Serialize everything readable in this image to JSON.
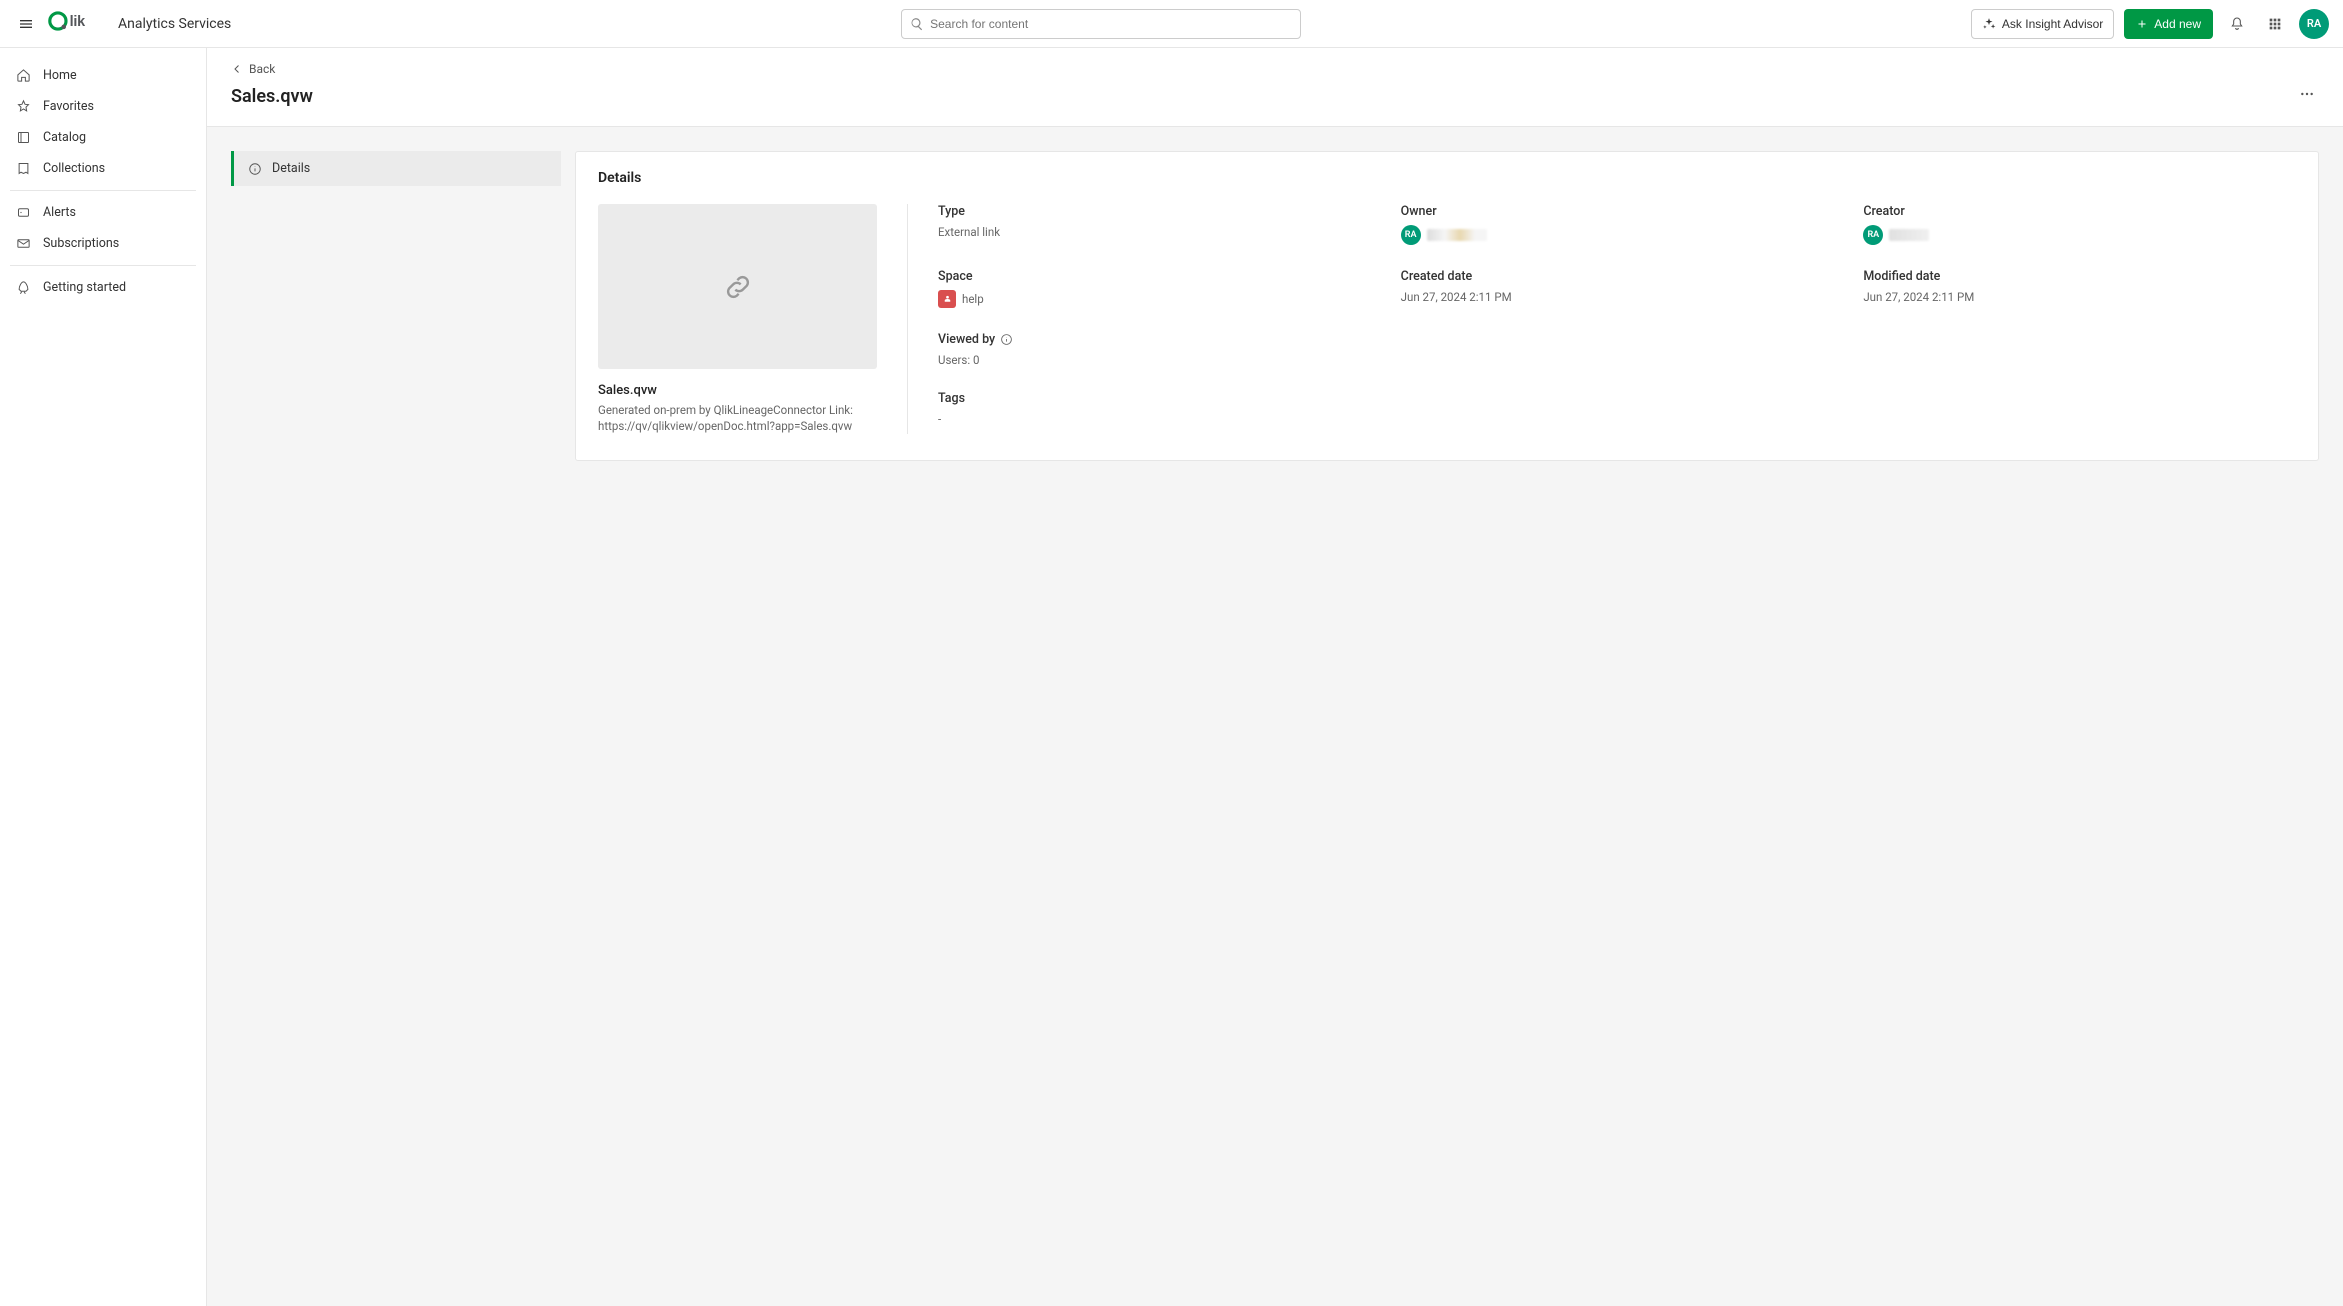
{
  "header": {
    "title": "Analytics Services",
    "search_placeholder": "Search for content",
    "ask_label": "Ask Insight Advisor",
    "add_label": "Add new",
    "user_initials": "RA"
  },
  "sidebar": {
    "items": [
      {
        "label": "Home"
      },
      {
        "label": "Favorites"
      },
      {
        "label": "Catalog"
      },
      {
        "label": "Collections"
      },
      {
        "label": "Alerts"
      },
      {
        "label": "Subscriptions"
      },
      {
        "label": "Getting started"
      }
    ]
  },
  "page": {
    "back_label": "Back",
    "title": "Sales.qvw"
  },
  "tabs": {
    "details_label": "Details"
  },
  "details": {
    "panel_title": "Details",
    "item_name": "Sales.qvw",
    "item_desc": "Generated on-prem by QlikLineageConnector Link: https://qv/qlikview/openDoc.html?app=Sales.qvw",
    "type_label": "Type",
    "type_value": "External link",
    "owner_label": "Owner",
    "owner_initials": "RA",
    "creator_label": "Creator",
    "creator_initials": "RA",
    "space_label": "Space",
    "space_value": "help",
    "created_label": "Created date",
    "created_value": "Jun 27, 2024 2:11 PM",
    "modified_label": "Modified date",
    "modified_value": "Jun 27, 2024 2:11 PM",
    "viewed_label": "Viewed by",
    "viewed_value": "Users: 0",
    "tags_label": "Tags",
    "tags_value": "-"
  }
}
